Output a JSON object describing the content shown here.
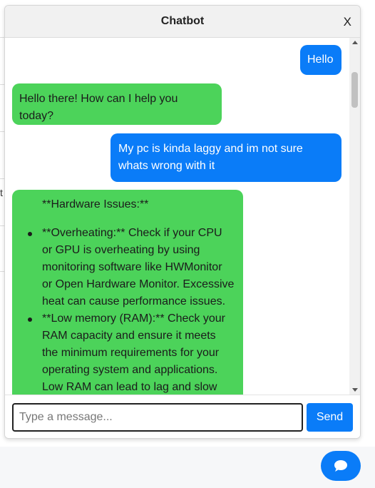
{
  "chat": {
    "title": "Chatbot",
    "close_label": "X",
    "messages": [
      {
        "role": "user",
        "text": "Hello"
      },
      {
        "role": "bot",
        "text": "Hello there! How can I help you today?"
      },
      {
        "role": "user",
        "text": "My pc is kinda laggy and im not sure whats wrong with it"
      },
      {
        "role": "bot",
        "heading": "**Hardware Issues:**",
        "items": [
          "**Overheating:** Check if your CPU or GPU is overheating by using monitoring software like HWMonitor or Open Hardware Monitor. Excessive heat can cause performance issues.",
          "**Low memory (RAM):** Check your RAM capacity and ensure it meets the minimum requirements for your operating system and applications. Low RAM can lead to lag and slow"
        ]
      }
    ],
    "input": {
      "placeholder": "Type a message...",
      "value": ""
    },
    "send_label": "Send"
  },
  "background": {
    "cut_text": "t"
  },
  "colors": {
    "user_bubble": "#0a7cf8",
    "bot_bubble": "#4cd35a",
    "send_button": "#0a7cf8"
  },
  "icons": {
    "launcher": "chat-bubble-icon",
    "scroll_up": "chevron-up-icon",
    "scroll_down": "chevron-down-icon"
  }
}
